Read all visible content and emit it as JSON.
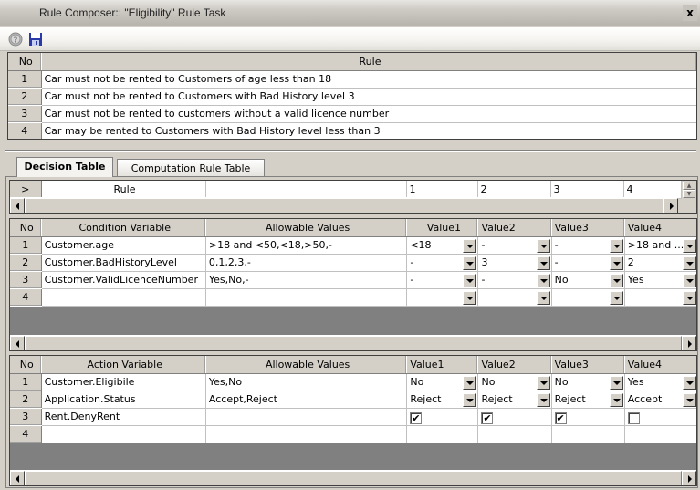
{
  "window": {
    "title": "Rule Composer:: \"Eligibility\" Rule Task",
    "close_label": "x"
  },
  "toolbar": {
    "icons": [
      "help-icon",
      "save-icon"
    ]
  },
  "rules_grid": {
    "headers": {
      "no": "No",
      "rule": "Rule"
    },
    "rows": [
      {
        "no": "1",
        "rule": "Car must not be rented to Customers of age less than 18"
      },
      {
        "no": "2",
        "rule": "Car must not be rented to Customers with Bad History level 3"
      },
      {
        "no": "3",
        "rule": "Car must not be rented to customers without a valid licence number"
      },
      {
        "no": "4",
        "rule": "Car may be rented to Customers with Bad History level less than 3"
      }
    ]
  },
  "tabs": [
    {
      "label": "Decision Table",
      "active": true
    },
    {
      "label": "Computation Rule Table",
      "active": false
    }
  ],
  "rule_header_grid": {
    "corner": ">",
    "label": "Rule",
    "rule_numbers": [
      "1",
      "2",
      "3",
      "4"
    ]
  },
  "condition_grid": {
    "headers": {
      "no": "No",
      "variable": "Condition Variable",
      "allowable": "Allowable Values",
      "values": [
        "Value1",
        "Value2",
        "Value3",
        "Value4"
      ]
    },
    "rows": [
      {
        "no": "1",
        "variable": "Customer.age",
        "allowable": ">18 and <50,<18,>50,-",
        "values": [
          "<18",
          "-",
          "-",
          ">18 and ..."
        ]
      },
      {
        "no": "2",
        "variable": "Customer.BadHistoryLevel",
        "allowable": "0,1,2,3,-",
        "values": [
          "-",
          "3",
          "-",
          "2"
        ]
      },
      {
        "no": "3",
        "variable": "Customer.ValidLicenceNumber",
        "allowable": "Yes,No,-",
        "values": [
          "-",
          "-",
          "No",
          "Yes"
        ]
      },
      {
        "no": "4",
        "variable": "",
        "allowable": "",
        "values": [
          "",
          "",
          "",
          ""
        ]
      }
    ]
  },
  "action_grid": {
    "headers": {
      "no": "No",
      "variable": "Action Variable",
      "allowable": "Allowable Values",
      "values": [
        "Value1",
        "Value2",
        "Value3",
        "Value4"
      ]
    },
    "rows": [
      {
        "no": "1",
        "variable": "Customer.Eligibile",
        "allowable": "Yes,No",
        "values": [
          "No",
          "No",
          "No",
          "Yes"
        ]
      },
      {
        "no": "2",
        "variable": "Application.Status",
        "allowable": "Accept,Reject",
        "values": [
          "Reject",
          "Reject",
          "Reject",
          "Accept"
        ]
      },
      {
        "no": "3",
        "variable": "Rent.DenyRent",
        "allowable": "",
        "checks": [
          true,
          true,
          true,
          false
        ]
      },
      {
        "no": "4",
        "variable": "",
        "allowable": ""
      }
    ]
  }
}
